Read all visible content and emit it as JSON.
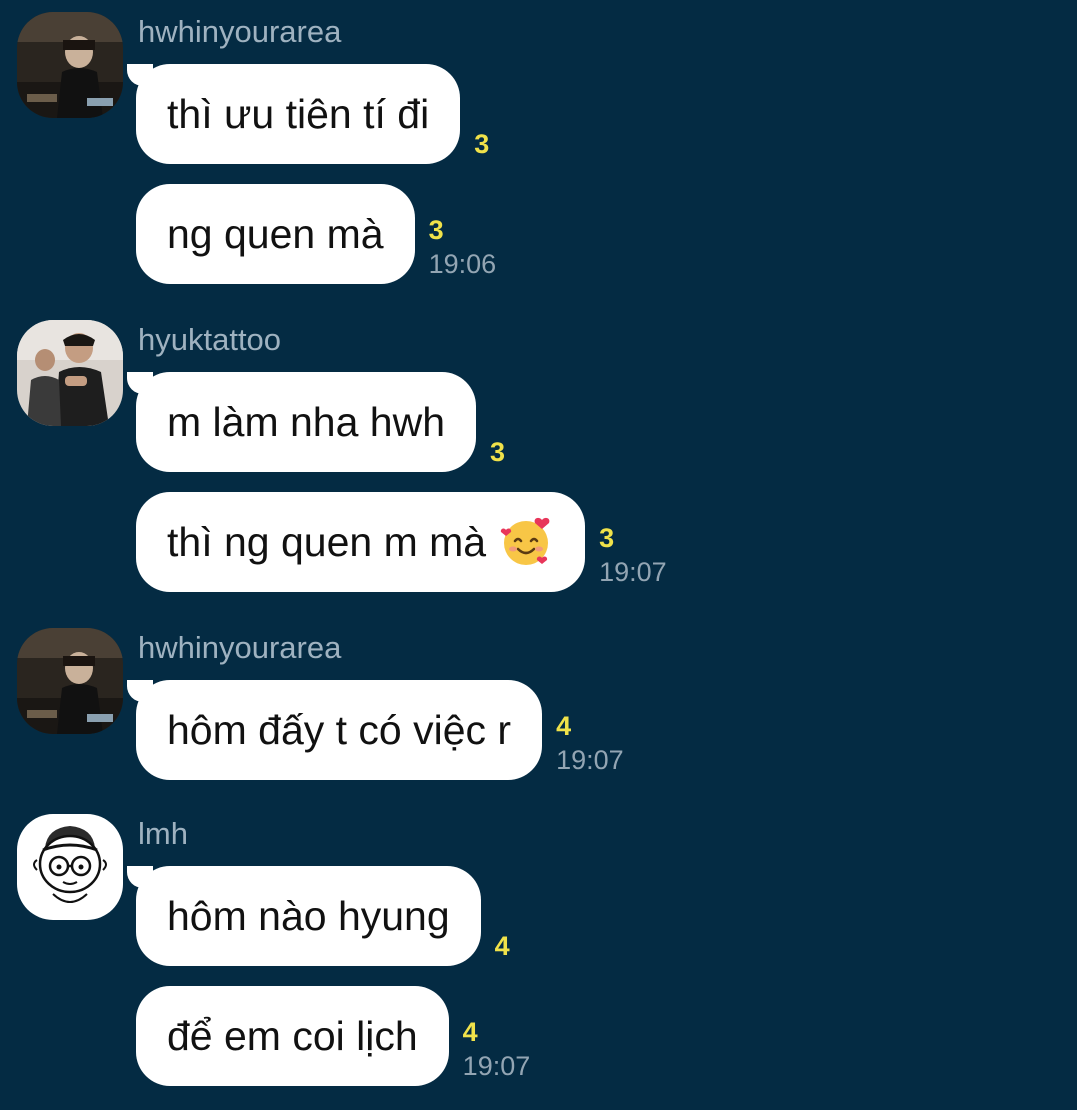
{
  "messages": [
    {
      "sender": "hwhinyourarea",
      "bubbles": [
        {
          "text": "thì ưu tiên tí đi",
          "count": "3",
          "time": ""
        },
        {
          "text": "ng quen mà",
          "count": "3",
          "time": "19:06"
        }
      ]
    },
    {
      "sender": "hyuktattoo",
      "bubbles": [
        {
          "text": "m làm nha hwh",
          "count": "3",
          "time": ""
        },
        {
          "text": "thì ng quen m mà",
          "emoji": "smiling-face-with-hearts",
          "count": "3",
          "time": "19:07"
        }
      ]
    },
    {
      "sender": "hwhinyourarea",
      "bubbles": [
        {
          "text": "hôm đấy t có việc r",
          "count": "4",
          "time": "19:07"
        }
      ]
    },
    {
      "sender": "lmh",
      "bubbles": [
        {
          "text": "hôm nào hyung",
          "count": "4",
          "time": ""
        },
        {
          "text": "để em coi lịch",
          "count": "4",
          "time": "19:07"
        }
      ]
    }
  ],
  "colors": {
    "background": "#042b43",
    "bubble": "#ffffff",
    "unread_count": "#f0e24a",
    "muted_text": "#9fb2c0"
  }
}
